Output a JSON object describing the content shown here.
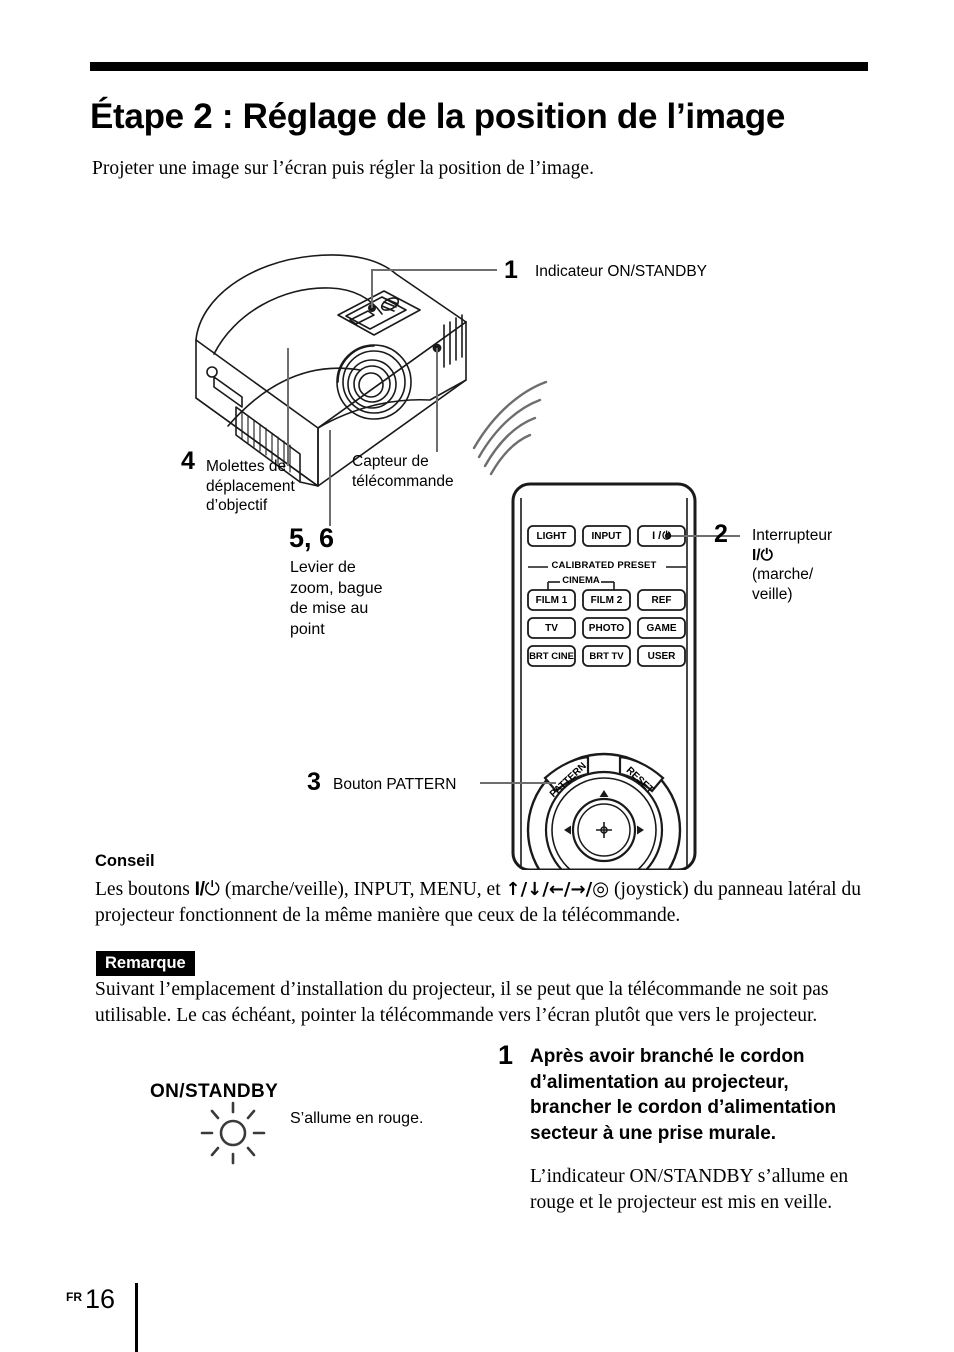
{
  "page": {
    "title": "Étape 2 : Réglage de la position de l’image",
    "intro": "Projeter une image sur l’écran puis régler la position de l’image.",
    "footer_lang": "FR",
    "footer_page": "16"
  },
  "figure": {
    "callouts": [
      {
        "number": "1",
        "label": "Indicateur ON/STANDBY"
      },
      {
        "number": "4",
        "label": "Molettes de\ndéplacement\nd’objectif"
      },
      {
        "number": "",
        "label": "Capteur de\ntélécommande"
      },
      {
        "number": "5, 6",
        "label": "Levier de\nzoom, bague\nde mise au\npoint"
      },
      {
        "number": "2",
        "label": "Interrupteur"
      },
      {
        "number": "3",
        "label": "Bouton PATTERN"
      }
    ],
    "callout_1_number": "1",
    "callout_1_label": "Indicateur ON/STANDBY",
    "callout_4_number": "4",
    "callout_4_label_l1": "Molettes de",
    "callout_4_label_l2": "déplacement",
    "callout_4_label_l3": "d’objectif",
    "callout_sensor_l1": "Capteur de",
    "callout_sensor_l2": "télécommande",
    "callout_56_number": "5, 6",
    "callout_56_l1": "Levier de",
    "callout_56_l2": "zoom, bague",
    "callout_56_l3": "de mise au",
    "callout_56_l4": "point",
    "callout_2_number": "2",
    "callout_2_l1": "Interrupteur",
    "callout_2_l2_power": "I/",
    "callout_2_l3": "(marche/",
    "callout_2_l4": "veille)",
    "callout_3_number": "3",
    "callout_3_label": "Bouton PATTERN"
  },
  "remote": {
    "top_row": [
      "LIGHT",
      "INPUT"
    ],
    "power_button": "I /",
    "group_label": "CALIBRATED PRESET",
    "cinema_label": "CINEMA",
    "preset_buttons": [
      [
        "FILM 1",
        "FILM 2",
        "REF"
      ],
      [
        "TV",
        "PHOTO",
        "GAME"
      ],
      [
        "BRT CINE",
        "BRT TV",
        "USER"
      ]
    ],
    "pattern_label": "PATTERN",
    "reset_label": "RESET"
  },
  "tip": {
    "heading": "Conseil",
    "text_part1": "Les boutons ",
    "power_sym": "I/",
    "text_part2": " (marche/veille), INPUT, MENU, et ",
    "arrows": "↑/↓/←/→/",
    "text_part3": " (joystick) du panneau latéral du projecteur fonctionnent de la même manière que ceux de la télécommande."
  },
  "note": {
    "badge": "Remarque",
    "text": "Suivant l’emplacement d’installation du projecteur, il se peut que la télécommande ne soit pas utilisable. Le cas échéant, pointer la télécommande vers l’écran plutôt que vers le projecteur."
  },
  "step": {
    "indicator_label": "ON/STANDBY",
    "indicator_caption": "S’allume en rouge.",
    "number": "1",
    "title": "Après avoir branché le cordon d’alimentation au projecteur, brancher le cordon d’alimentation secteur à une prise murale.",
    "description": "L’indicateur ON/STANDBY s’allume en rouge et le projecteur est mis en veille."
  },
  "colors": {
    "ink": "#000000",
    "leader_line": "#6e6e6e",
    "ir_wave": "#6e6e6e"
  }
}
